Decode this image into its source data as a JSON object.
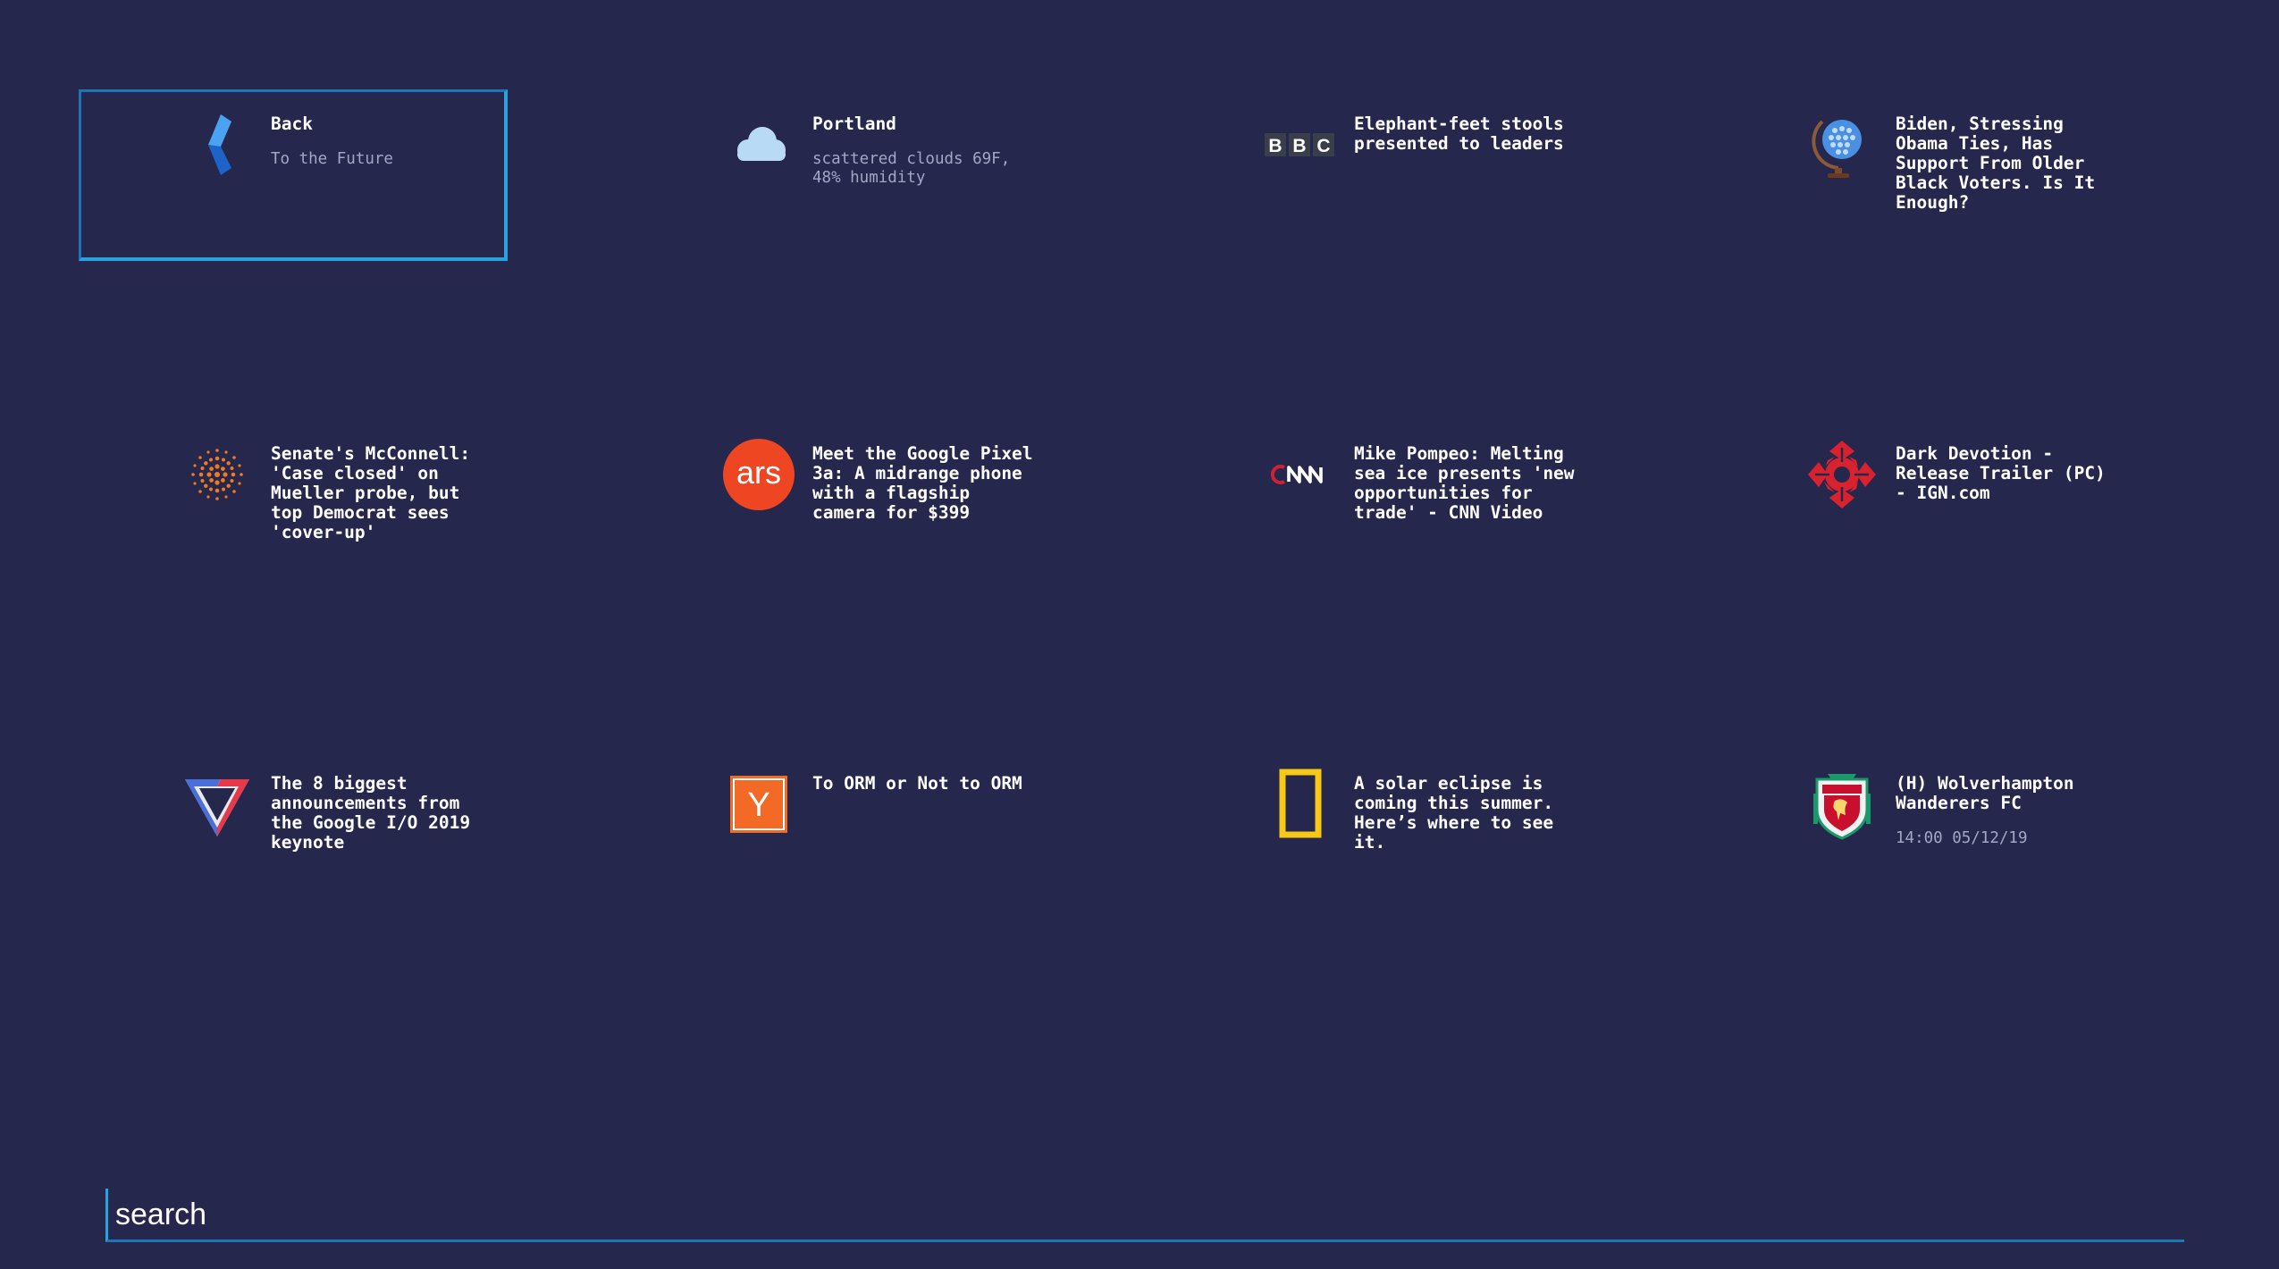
{
  "tiles": [
    {
      "name": "tile-back",
      "icon": "chevron-left-icon",
      "title": "Back",
      "subtitle": "To the Future"
    },
    {
      "name": "tile-weather-portland",
      "icon": "cloud-icon",
      "title": "Portland",
      "subtitle": "scattered clouds 69F,\n48% humidity"
    },
    {
      "name": "tile-bbc",
      "icon": "bbc-logo-icon",
      "title": "Elephant-feet stools\npresented to leaders",
      "subtitle": ""
    },
    {
      "name": "tile-nyt-globe",
      "icon": "globe-icon",
      "title": "Biden, Stressing\nObama Ties, Has\nSupport From Older\nBlack Voters. Is It\nEnough?",
      "subtitle": ""
    },
    {
      "name": "tile-reuters",
      "icon": "reuters-logo-icon",
      "title": "Senate's McConnell:\n'Case closed' on\nMueller probe, but\ntop Democrat sees\n'cover-up'",
      "subtitle": ""
    },
    {
      "name": "tile-ars",
      "icon": "ars-logo-icon",
      "title": "Meet the Google Pixel\n3a: A midrange phone\nwith a flagship\ncamera for $399",
      "subtitle": ""
    },
    {
      "name": "tile-cnn",
      "icon": "cnn-logo-icon",
      "title": "Mike Pompeo: Melting\nsea ice presents 'new\nopportunities for\ntrade' - CNN Video",
      "subtitle": ""
    },
    {
      "name": "tile-ign",
      "icon": "ign-logo-icon",
      "title": "Dark Devotion -\nRelease Trailer (PC)\n- IGN.com",
      "subtitle": ""
    },
    {
      "name": "tile-verge",
      "icon": "verge-logo-icon",
      "title": "The 8 biggest\nannouncements from\nthe Google I/O 2019\nkeynote",
      "subtitle": ""
    },
    {
      "name": "tile-hackernews",
      "icon": "ycombinator-logo-icon",
      "title": "To ORM or Not to ORM",
      "subtitle": ""
    },
    {
      "name": "tile-natgeo",
      "icon": "natgeo-logo-icon",
      "title": "A solar eclipse is\ncoming this summer.\nHere’s where to see\nit.",
      "subtitle": ""
    },
    {
      "name": "tile-liverpool",
      "icon": "liverpool-crest-icon",
      "title": "(H) Wolverhampton\nWanderers FC",
      "subtitle": "14:00 05/12/19"
    }
  ],
  "search": {
    "placeholder": "search",
    "value": ""
  },
  "colors": {
    "background": "#25274d",
    "selection_border": "#2aa2e0",
    "subtitle_text": "#a3a6c4"
  }
}
